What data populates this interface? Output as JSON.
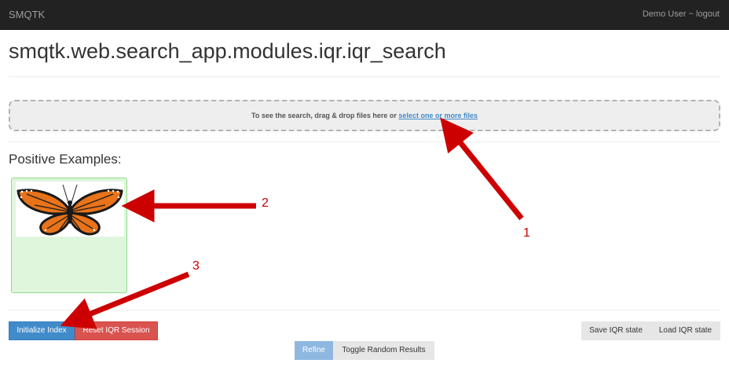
{
  "navbar": {
    "brand": "SMQTK",
    "user_logout": "Demo User ~ logout"
  },
  "page": {
    "title": "smqtk.web.search_app.modules.iqr.iqr_search"
  },
  "dropzone": {
    "text": "To see the search, drag & drop files here or ",
    "link": "select one or more files"
  },
  "positive": {
    "title": "Positive Examples:"
  },
  "buttons": {
    "init_index": "Initialize Index",
    "reset_session": "Reset IQR Session",
    "save_state": "Save IQR state",
    "load_state": "Load IQR state",
    "refine": "Refine",
    "toggle_random": "Toggle Random Results"
  },
  "annotations": {
    "n1": "1",
    "n2": "2",
    "n3": "3"
  },
  "colors": {
    "arrow": "#cc0000",
    "primary": "#428bca",
    "danger": "#d9534f",
    "positive_bg": "#dff6dc"
  }
}
